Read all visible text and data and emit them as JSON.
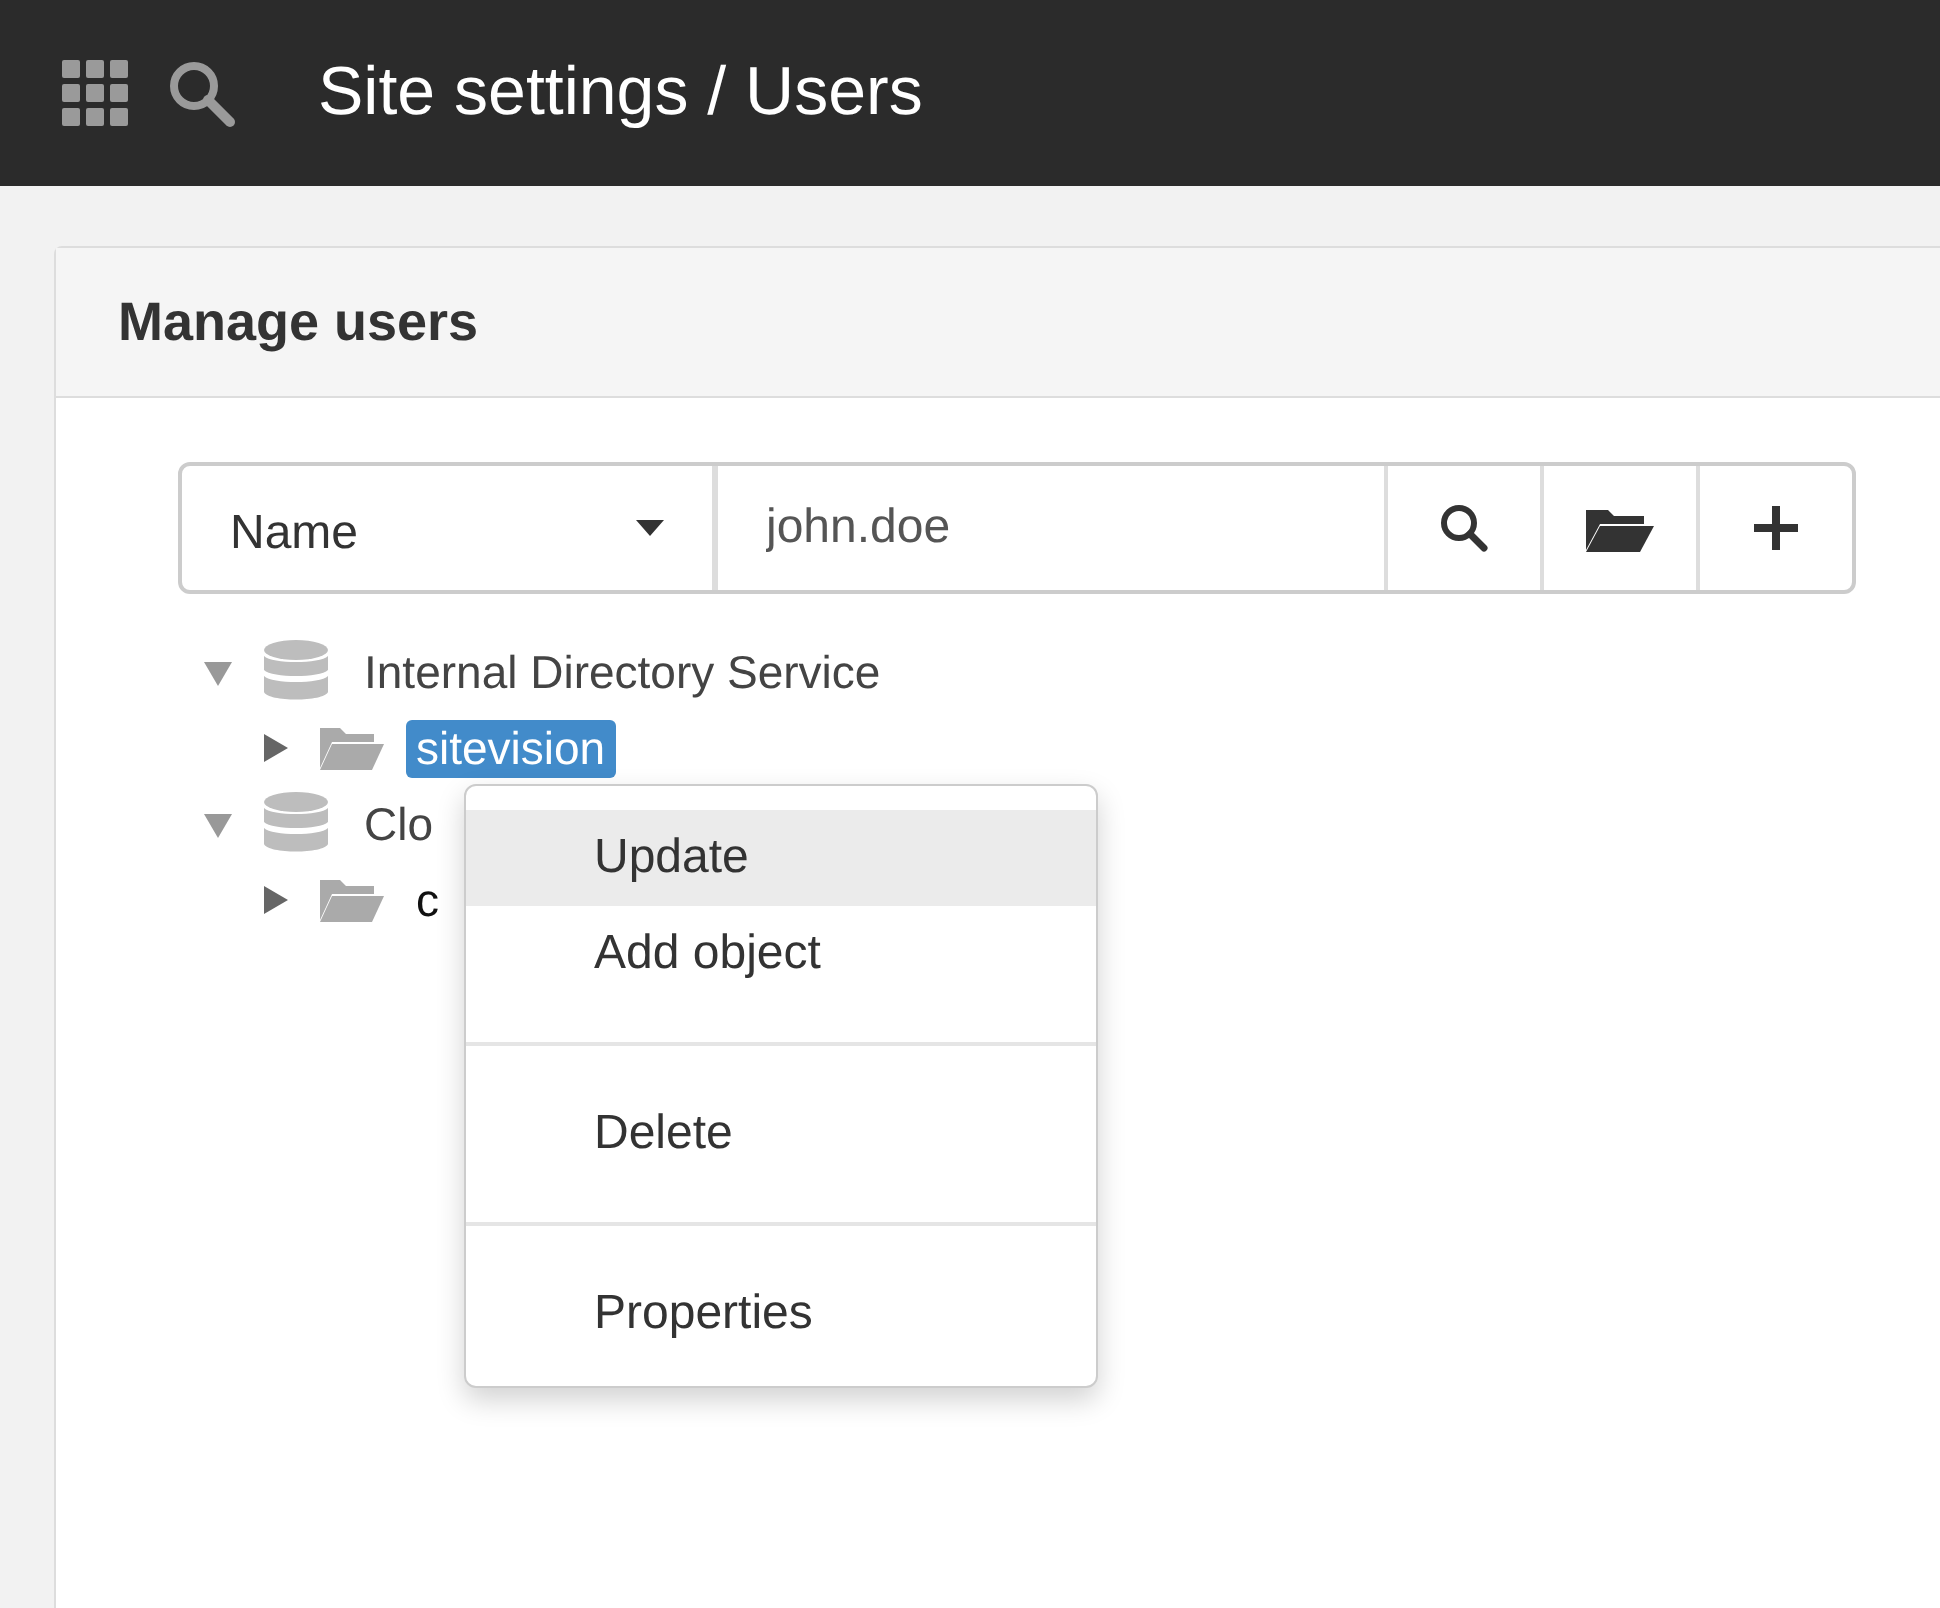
{
  "header": {
    "title": "Site settings / Users"
  },
  "panel": {
    "title": "Manage users",
    "search": {
      "field": "Name",
      "value": "john.doe"
    },
    "tree": [
      {
        "label": "Internal Directory Service",
        "kind": "directory",
        "expanded": true,
        "selected": false,
        "children": [
          {
            "label": "sitevision",
            "kind": "folder",
            "expanded": false,
            "selected": true
          }
        ]
      },
      {
        "label": "Clo",
        "kind": "directory",
        "expanded": true,
        "selected": false,
        "children": [
          {
            "label": "c",
            "kind": "folder",
            "expanded": false,
            "selected": false
          }
        ]
      }
    ]
  },
  "context_menu": {
    "items": [
      {
        "kind": "item",
        "label": "Update",
        "selected": true
      },
      {
        "kind": "item",
        "label": "Add object",
        "selected": false
      },
      {
        "kind": "divider"
      },
      {
        "kind": "item",
        "label": "Delete",
        "selected": false
      },
      {
        "kind": "divider"
      },
      {
        "kind": "item",
        "label": "Properties",
        "selected": false
      }
    ]
  }
}
